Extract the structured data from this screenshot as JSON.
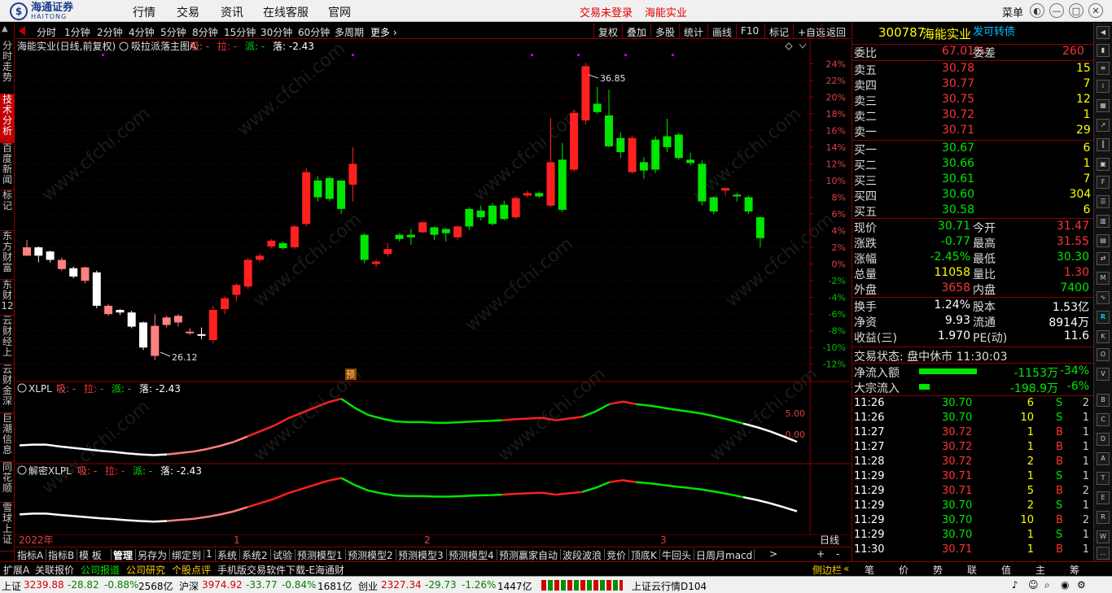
{
  "app": {
    "broker_cn": "海通证券",
    "broker_en": "HAITONG",
    "menu": [
      "行情",
      "交易",
      "资讯",
      "在线客服",
      "官网"
    ],
    "login_status": "交易未登录",
    "stock_title": "海能实业",
    "menu_button": "菜单"
  },
  "left_nav": [
    "分时走势",
    "技术分析",
    "百度新闻",
    "标记",
    "东方财富",
    "东财12",
    "云财经上",
    "云财金深",
    "巨潮信息",
    "同花顺",
    "雪球上证"
  ],
  "periods": [
    "分时",
    "1分钟",
    "2分钟",
    "4分钟",
    "5分钟",
    "8分钟",
    "15分钟",
    "30分钟",
    "60分钟",
    "多周期",
    "更多"
  ],
  "right_buttons": [
    "复权",
    "叠加",
    "多股",
    "统计",
    "画线",
    "F10",
    "标记",
    "+自选",
    "返回"
  ],
  "chart": {
    "main_title": "海能实业(日线,前复权)",
    "main_indicator": "吸拉派落主图A",
    "main_legend": [
      {
        "label": "吸:",
        "value": "-",
        "color": "#ff5050"
      },
      {
        "label": "拉:",
        "value": "-",
        "color": "#ff3030"
      },
      {
        "label": "派:",
        "value": "-",
        "color": "#00e600"
      },
      {
        "label": "落:",
        "value": "-2.43",
        "color": "#ffffff"
      }
    ],
    "high_label": "36.85",
    "low_label": "26.12",
    "pre_tag": "预",
    "y_ticks": [
      "24%",
      "22%",
      "20%",
      "18%",
      "16%",
      "14%",
      "12%",
      "10%",
      "8%",
      "6%",
      "4%",
      "2%",
      "0%",
      "-2%",
      "-4%",
      "-6%",
      "-8%",
      "-10%",
      "-12%"
    ],
    "sub1_title": "XLPL",
    "sub1_legend": [
      {
        "label": "吸:",
        "value": "-",
        "color": "#ff5050"
      },
      {
        "label": "拉:",
        "value": "-",
        "color": "#ff3030"
      },
      {
        "label": "派:",
        "value": "-",
        "color": "#00e600"
      },
      {
        "label": "落:",
        "value": "-2.43",
        "color": "#ffffff"
      }
    ],
    "sub1_ticks": [
      "5.00",
      "0.00"
    ],
    "sub2_title": "解密XLPL",
    "sub2_legend": [
      {
        "label": "吸:",
        "value": "-",
        "color": "#ff5050"
      },
      {
        "label": "拉:",
        "value": "-",
        "color": "#ff3030"
      },
      {
        "label": "派:",
        "value": "-",
        "color": "#00e600"
      },
      {
        "label": "落:",
        "value": "-2.43",
        "color": "#ffffff"
      }
    ],
    "x_labels": [
      "2022年",
      "1",
      "2",
      "3"
    ],
    "period_label": "日线",
    "watermark": "www.cfchi.com"
  },
  "chart_data": {
    "type": "candlestick",
    "y_unit": "percent",
    "ylim": [
      -13,
      25
    ],
    "candles": [
      [
        1,
        2,
        2.9,
        1
      ],
      [
        2,
        1,
        2.1,
        0.2
      ],
      [
        1.5,
        0.5,
        1.6,
        0.2
      ],
      [
        -0.6,
        0.5,
        0.8,
        -0.8
      ],
      [
        -0.5,
        -1.5,
        -0.3,
        -1.7
      ],
      [
        -2,
        -0.4,
        -0.3,
        -2.3
      ],
      [
        -1,
        -5,
        -0.8,
        -5.3
      ],
      [
        -6,
        -5,
        -4.8,
        -6.2
      ],
      [
        -5.5,
        -5.8,
        -5.4,
        -6.1
      ],
      [
        -5.8,
        -7.5,
        -5.6,
        -7.7
      ],
      [
        -7,
        -10,
        -6.9,
        -10.3
      ],
      [
        -11,
        -7.4,
        -6,
        -11.5
      ],
      [
        -7.3,
        -6.4,
        -6.2,
        -7.6
      ],
      [
        -7,
        -6.2,
        -6,
        -7.5
      ],
      [
        -8.3,
        -8.1,
        -7.7,
        -8.5
      ],
      [
        -8.4,
        -8.6,
        -7.6,
        -9
      ],
      [
        -9.1,
        -5.5,
        -5,
        -9.5
      ],
      [
        -5.4,
        -4.1,
        -3.9,
        -6
      ],
      [
        -3.7,
        -2.5,
        -2.3,
        -4.5
      ],
      [
        -2.7,
        0.5,
        0.7,
        -3
      ],
      [
        0.5,
        1,
        1.3,
        0.2
      ],
      [
        2.1,
        2.8,
        3,
        1.9
      ],
      [
        2.5,
        1.9,
        2.7,
        1.7
      ],
      [
        2,
        4.5,
        4.7,
        1.8
      ],
      [
        4.8,
        11,
        11.5,
        4.5
      ],
      [
        10,
        8,
        10.5,
        7.5
      ],
      [
        10.3,
        7.8,
        10.5,
        7.5
      ],
      [
        10,
        6.6,
        9,
        6
      ],
      [
        9.5,
        12,
        14,
        7.5
      ],
      [
        3.5,
        0.5,
        3.7,
        0.1
      ],
      [
        0,
        0.3,
        0.5,
        -0.4
      ],
      [
        1.2,
        1.8,
        2.5,
        0.9
      ],
      [
        3.5,
        3,
        3.7,
        2.7
      ],
      [
        3.5,
        3.2,
        4.2,
        2.3
      ],
      [
        3.8,
        5,
        5.1,
        3.7
      ],
      [
        4.4,
        3.5,
        4.5,
        2.9
      ],
      [
        4.2,
        3.7,
        4.3,
        2.7
      ],
      [
        3.2,
        4.5,
        4.6,
        2.9
      ],
      [
        6.6,
        4.5,
        6.8,
        4.1
      ],
      [
        6.4,
        5.6,
        7,
        5.2
      ],
      [
        7,
        4.8,
        7.3,
        4.6
      ],
      [
        7.1,
        5.4,
        7.6,
        5.2
      ],
      [
        5.6,
        7.9,
        8.1,
        5.4
      ],
      [
        8.2,
        8.5,
        8.8,
        8
      ],
      [
        8.5,
        8.1,
        8.7,
        7.9
      ],
      [
        7,
        12.2,
        17.5,
        6.8
      ],
      [
        12.5,
        6.5,
        14.5,
        6.2
      ],
      [
        11.3,
        18.1,
        18.5,
        11
      ],
      [
        17.2,
        23.7,
        24.1,
        16.7
      ],
      [
        19.2,
        18.2,
        21.2,
        18
      ],
      [
        17.8,
        14.1,
        20.9,
        14
      ],
      [
        15.1,
        13.4,
        15.8,
        12.7
      ],
      [
        11,
        15.1,
        15.4,
        10.8
      ],
      [
        12.2,
        11.2,
        12.8,
        10.2
      ],
      [
        14.9,
        11.3,
        15.3,
        10.9
      ],
      [
        15.3,
        14,
        17.4,
        13.4
      ],
      [
        15.5,
        12.7,
        15.7,
        12.5
      ],
      [
        12.5,
        12.1,
        13.3,
        11.8
      ],
      [
        12,
        7.5,
        12.4,
        7
      ],
      [
        8,
        6.3,
        8.1,
        6
      ],
      [
        8.8,
        9.1,
        9.1,
        8.2
      ],
      [
        8.3,
        8.1,
        8.5,
        7.5
      ],
      [
        8,
        6.3,
        8.2,
        6
      ],
      [
        5.6,
        3.1,
        5.7,
        2
      ]
    ],
    "sub1_line": [
      -1.5,
      -1.3,
      -1.3,
      -1.8,
      -2.2,
      -2.6,
      -3.0,
      -3.3,
      -3.7,
      -4.0,
      -4.2,
      -4.0,
      -3.6,
      -3.2,
      -2.5,
      -1.6,
      -0.5,
      1.0,
      2.5,
      4.0,
      6.0,
      7.5,
      9.0,
      10.5,
      11.5,
      9.0,
      7.0,
      6.0,
      5.2,
      5.0,
      5.0,
      4.8,
      4.8,
      5.0,
      5.2,
      5.3,
      5.5,
      5.8,
      6.0,
      6.2,
      5.5,
      6.0,
      6.5,
      8.0,
      10.0,
      10.7,
      10.0,
      9.6,
      9.0,
      8.4,
      7.9,
      7.3,
      6.5,
      5.6,
      4.6,
      3.6,
      2.4,
      1.0,
      -0.5
    ],
    "sub2_line": [
      -1.0,
      -0.7,
      -0.7,
      -1.2,
      -1.6,
      -2.0,
      -2.4,
      -2.7,
      -3.1,
      -3.4,
      -3.6,
      -3.4,
      -3.0,
      -2.6,
      -1.9,
      -1.0,
      0.1,
      1.6,
      3.1,
      4.6,
      6.6,
      8.1,
      9.6,
      11.1,
      12.1,
      9.6,
      7.6,
      6.6,
      5.8,
      5.6,
      5.6,
      5.4,
      5.4,
      5.6,
      5.8,
      5.9,
      6.1,
      6.4,
      6.6,
      6.8,
      6.1,
      6.6,
      7.1,
      8.6,
      10.6,
      11.3,
      10.6,
      10.2,
      9.6,
      9.0,
      8.5,
      7.9,
      7.1,
      6.2,
      5.2,
      4.2,
      3.0,
      1.6,
      0.1
    ]
  },
  "quote": {
    "code": "300787",
    "name": "海能实业",
    "link": "发可转债",
    "weibi_label": "委比",
    "weibi": "67.01%",
    "weicha_label": "委差",
    "weicha": "260",
    "asks": [
      {
        "label": "卖五",
        "price": "30.78",
        "vol": "15"
      },
      {
        "label": "卖四",
        "price": "30.77",
        "vol": "7"
      },
      {
        "label": "卖三",
        "price": "30.75",
        "vol": "12"
      },
      {
        "label": "卖二",
        "price": "30.72",
        "vol": "1"
      },
      {
        "label": "卖一",
        "price": "30.71",
        "vol": "29"
      }
    ],
    "bids": [
      {
        "label": "买一",
        "price": "30.67",
        "vol": "6"
      },
      {
        "label": "买二",
        "price": "30.66",
        "vol": "1"
      },
      {
        "label": "买三",
        "price": "30.61",
        "vol": "7"
      },
      {
        "label": "买四",
        "price": "30.60",
        "vol": "304"
      },
      {
        "label": "买五",
        "price": "30.58",
        "vol": "6"
      }
    ],
    "stats": [
      {
        "l1": "现价",
        "v1": "30.71",
        "c1": "green",
        "l2": "今开",
        "v2": "31.47",
        "c2": "red"
      },
      {
        "l1": "涨跌",
        "v1": "-0.77",
        "c1": "green",
        "l2": "最高",
        "v2": "31.55",
        "c2": "red"
      },
      {
        "l1": "涨幅",
        "v1": "-2.45%",
        "c1": "green",
        "l2": "最低",
        "v2": "30.30",
        "c2": "green"
      },
      {
        "l1": "总量",
        "v1": "11058",
        "c1": "yellow",
        "l2": "量比",
        "v2": "1.30",
        "c2": "red"
      },
      {
        "l1": "外盘",
        "v1": "3658",
        "c1": "red",
        "l2": "内盘",
        "v2": "7400",
        "c2": "green"
      }
    ],
    "stats2": [
      {
        "l1": "换手",
        "v1": "1.24%",
        "l2": "股本",
        "v2": "1.53亿"
      },
      {
        "l1": "净资",
        "v1": "9.93",
        "l2": "流通",
        "v2": "8914万"
      },
      {
        "l1": "收益(三)",
        "v1": "1.970",
        "l2": "PE(动)",
        "v2": "11.6"
      }
    ],
    "trade_state": "交易状态: 盘中休市 11:30:03",
    "flows": [
      {
        "label": "净流入额",
        "value": "-1153万",
        "pct": "-34%",
        "fill": 0.34
      },
      {
        "label": "大宗流入",
        "value": "-198.9万",
        "pct": "-6%",
        "fill": 0.06
      }
    ],
    "ticks": [
      {
        "t": "11:26",
        "p": "30.70",
        "v": "6",
        "d": "S",
        "n": "2"
      },
      {
        "t": "11:26",
        "p": "30.70",
        "v": "10",
        "d": "S",
        "n": "1"
      },
      {
        "t": "11:27",
        "p": "30.72",
        "v": "1",
        "d": "B",
        "n": "1"
      },
      {
        "t": "11:27",
        "p": "30.72",
        "v": "1",
        "d": "B",
        "n": "1"
      },
      {
        "t": "11:28",
        "p": "30.72",
        "v": "2",
        "d": "B",
        "n": "1"
      },
      {
        "t": "11:29",
        "p": "30.71",
        "v": "1",
        "d": "S",
        "n": "1"
      },
      {
        "t": "11:29",
        "p": "30.71",
        "v": "5",
        "d": "B",
        "n": "2"
      },
      {
        "t": "11:29",
        "p": "30.70",
        "v": "2",
        "d": "S",
        "n": "1"
      },
      {
        "t": "11:29",
        "p": "30.70",
        "v": "10",
        "d": "B",
        "n": "2"
      },
      {
        "t": "11:29",
        "p": "30.70",
        "v": "1",
        "d": "S",
        "n": "1"
      },
      {
        "t": "11:30",
        "p": "30.71",
        "v": "1",
        "d": "B",
        "n": "1"
      }
    ],
    "bottom_tabs": [
      "笔",
      "价",
      "势",
      "联",
      "值",
      "主",
      "筹"
    ]
  },
  "bottom_tabs": [
    "指标A",
    "指标B",
    "模 板",
    "管理",
    "另存为",
    "绑定到",
    "1",
    "系统",
    "系统2",
    "试验",
    "预测模型1",
    "预测模型2",
    "预测模型3",
    "预测模型4",
    "预测赢家自动",
    "波段波浪",
    "竞价",
    "顶底K",
    "牛回头",
    "日周月macd"
  ],
  "info_tabs": [
    "扩展A",
    "关联报价",
    "公司报道",
    "公司研究",
    "个股点评",
    "手机版交易软件下载-E海通财"
  ],
  "sidebar_toggle": "侧边栏",
  "status": {
    "sh_label": "上证",
    "sh": "3239.88",
    "sh_chg": "-28.82",
    "sh_pct": "-0.88%",
    "sh_amt": "2568亿",
    "hs_label": "沪深",
    "hs": "3974.92",
    "hs_chg": "-33.77",
    "hs_pct": "-0.84%",
    "hs_amt": "1681亿",
    "cy_label": "创业",
    "cy": "2327.34",
    "cy_chg": "-29.73",
    "cy_pct": "-1.26%",
    "cy_amt": "1447亿",
    "cloud": "上证云行情D104"
  }
}
